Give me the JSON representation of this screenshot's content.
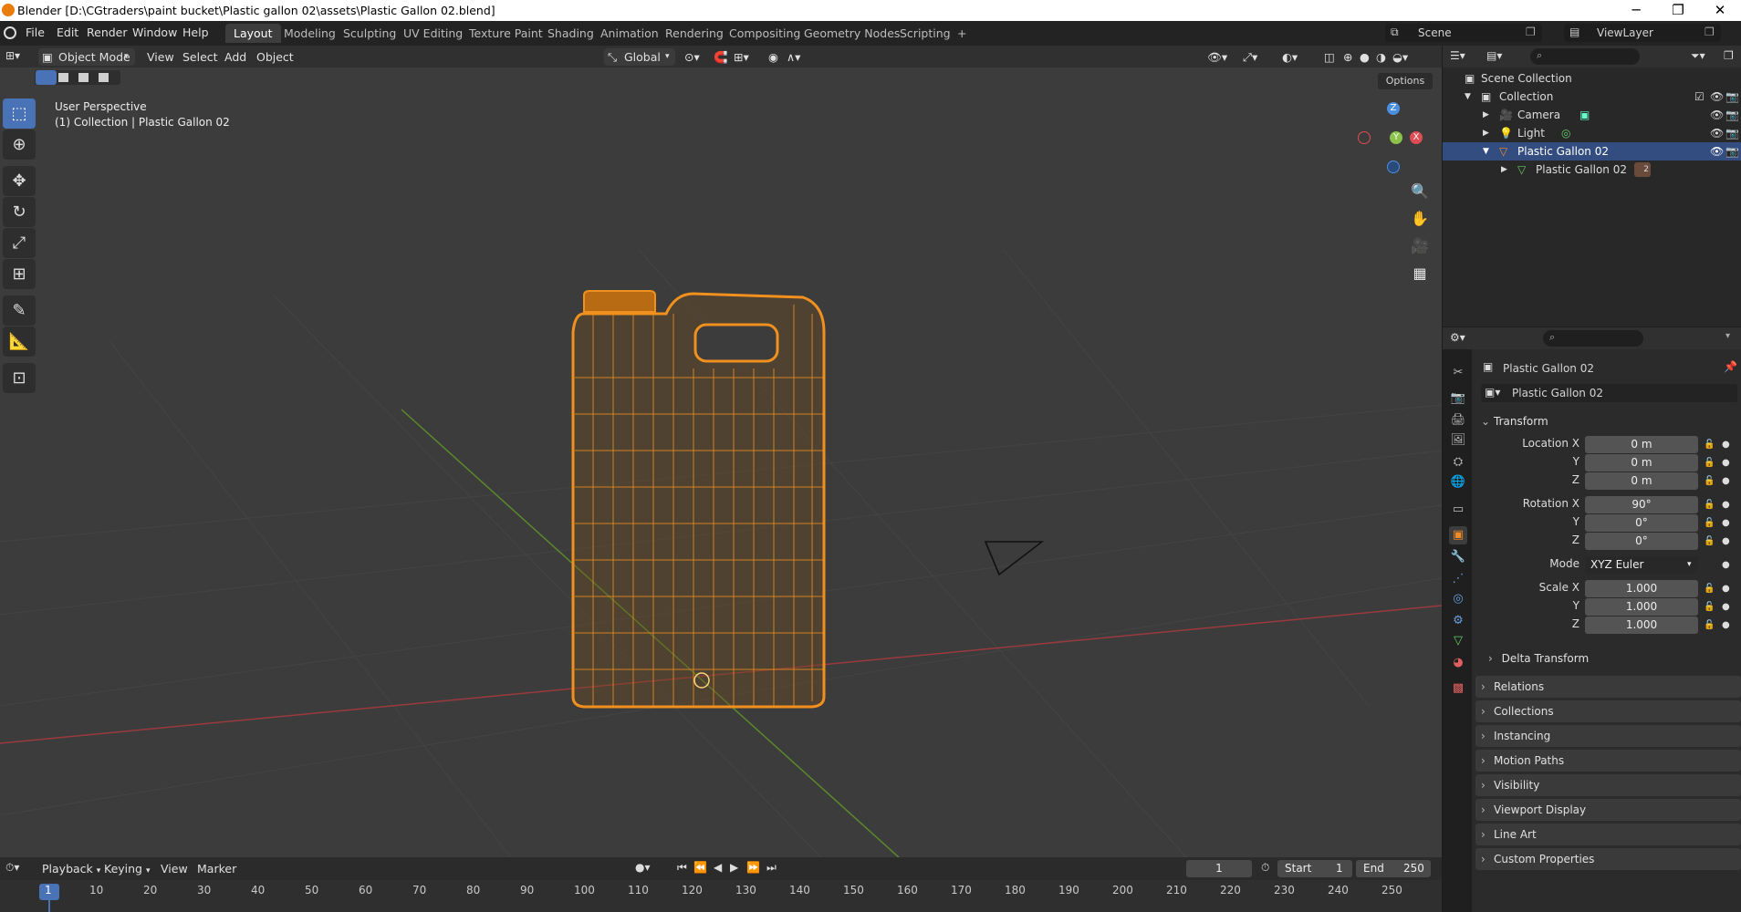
{
  "window": {
    "title": "Blender [D:\\CGtraders\\paint bucket\\Plastic gallon 02\\assets\\Plastic Gallon 02.blend]",
    "minimize": "─",
    "maximize": "❐",
    "close": "✕"
  },
  "menu": [
    "File",
    "Edit",
    "Render",
    "Window",
    "Help"
  ],
  "workspaces": [
    "Layout",
    "Modeling",
    "Sculpting",
    "UV Editing",
    "Texture Paint",
    "Shading",
    "Animation",
    "Rendering",
    "Compositing",
    "Geometry Nodes",
    "Scripting"
  ],
  "workspace_add": "+",
  "scene": {
    "label": "Scene",
    "viewlayer": "ViewLayer"
  },
  "viewport_header": {
    "mode": "Object Mode",
    "menus": [
      "View",
      "Select",
      "Add",
      "Object"
    ],
    "orientation": "Global",
    "options": "Options"
  },
  "viewport": {
    "info_line1": "User Perspective",
    "info_line2": "(1) Collection | Plastic Gallon 02",
    "gizmo": {
      "x": "X",
      "y": "Y",
      "z": "Z"
    }
  },
  "outliner": {
    "rows": [
      {
        "label": "Scene Collection"
      },
      {
        "label": "Collection"
      },
      {
        "label": "Camera"
      },
      {
        "label": "Light"
      },
      {
        "label": "Plastic Gallon 02"
      },
      {
        "label": "Plastic Gallon 02"
      }
    ],
    "mesh_badge": "2"
  },
  "properties": {
    "object_name": "Plastic Gallon 02",
    "datablock_name": "Plastic Gallon 02",
    "transform_title": "Transform",
    "location": {
      "label": "Location X",
      "x": "0 m",
      "y": "0 m",
      "z": "0 m"
    },
    "rotation": {
      "label": "Rotation X",
      "x": "90°",
      "y": "0°",
      "z": "0°"
    },
    "axis_y": "Y",
    "axis_z": "Z",
    "mode": {
      "label": "Mode",
      "value": "XYZ Euler"
    },
    "scale": {
      "label": "Scale X",
      "x": "1.000",
      "y": "1.000",
      "z": "1.000"
    },
    "delta": "Delta Transform",
    "panels": [
      "Relations",
      "Collections",
      "Instancing",
      "Motion Paths",
      "Visibility",
      "Viewport Display",
      "Line Art",
      "Custom Properties"
    ]
  },
  "timeline": {
    "menus": [
      "Playback",
      "Keying",
      "View",
      "Marker"
    ],
    "current_frame": "1",
    "start_label": "Start",
    "start": "1",
    "end_label": "End",
    "end": "250",
    "ticks": [
      "1",
      "10",
      "20",
      "30",
      "40",
      "50",
      "60",
      "70",
      "80",
      "90",
      "100",
      "110",
      "120",
      "130",
      "140",
      "150",
      "160",
      "170",
      "180",
      "190",
      "200",
      "210",
      "220",
      "230",
      "240",
      "250"
    ]
  },
  "colors": {
    "accent_orange": "#f08a24",
    "selection_blue": "#334d80",
    "axis_x": "#e04c54",
    "axis_y": "#8bc34a",
    "axis_z": "#4a8fe0"
  }
}
